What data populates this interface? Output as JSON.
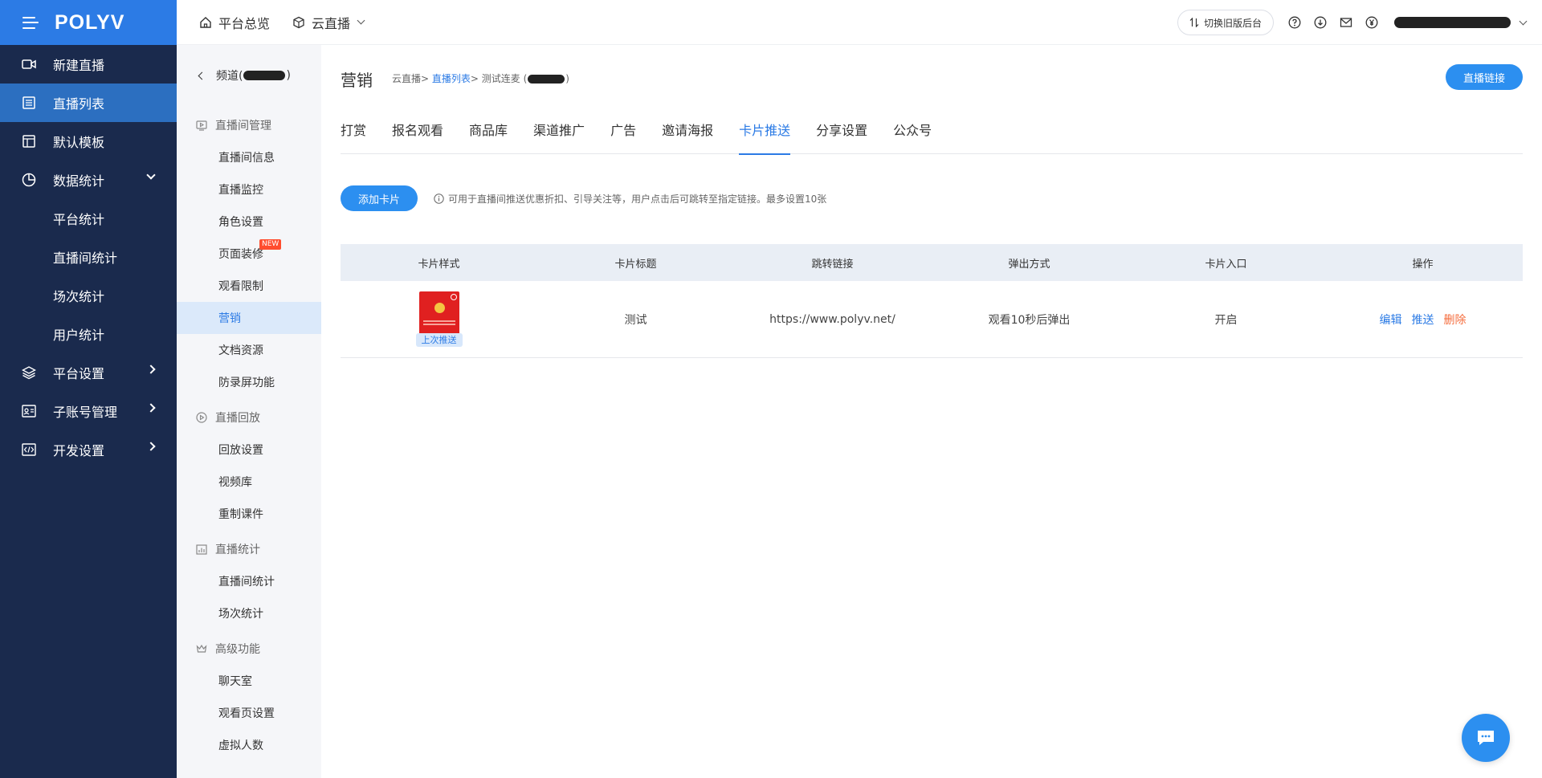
{
  "brand": {
    "logo": "POLYV",
    "accent": "#2c7be5",
    "nav_bg": "#1a2a4d"
  },
  "nav": [
    {
      "label": "新建直播",
      "icon": "video-camera-icon",
      "active": false
    },
    {
      "label": "直播列表",
      "icon": "list-icon",
      "active": true
    },
    {
      "label": "默认模板",
      "icon": "template-icon",
      "active": false
    },
    {
      "label": "数据统计",
      "icon": "pie-chart-icon",
      "expanded": true
    },
    {
      "label": "平台统计"
    },
    {
      "label": "直播间统计"
    },
    {
      "label": "场次统计"
    },
    {
      "label": "用户统计"
    },
    {
      "label": "平台设置",
      "icon": "layers-icon"
    },
    {
      "label": "子账号管理",
      "icon": "id-card-icon"
    },
    {
      "label": "开发设置",
      "icon": "code-icon"
    }
  ],
  "topbar": {
    "overview": "平台总览",
    "cloud_live": "云直播",
    "switch_old": "切换旧版后台",
    "icons": [
      "help-icon",
      "download-icon",
      "mail-icon",
      "yen-icon"
    ]
  },
  "submenu": {
    "back_label_prefix": "频道(",
    "back_label_suffix": ")",
    "groups": [
      {
        "title": "直播间管理",
        "items": [
          "直播间信息",
          "直播监控",
          "角色设置",
          "页面装修",
          "观看限制",
          "营销",
          "文档资源",
          "防录屏功能"
        ]
      },
      {
        "title": "直播回放",
        "items": [
          "回放设置",
          "视频库",
          "重制课件"
        ]
      },
      {
        "title": "直播统计",
        "items": [
          "直播间统计",
          "场次统计"
        ]
      },
      {
        "title": "高级功能",
        "items": [
          "聊天室",
          "观看页设置",
          "虚拟人数"
        ]
      }
    ],
    "new_badge": "NEW"
  },
  "page": {
    "title": "营销",
    "breadcrumb": {
      "root": "云直播>",
      "list": "直播列表",
      "sep": ">",
      "current_prefix": "测试连麦 (",
      "current_suffix": ")"
    },
    "live_link_btn": "直播链接",
    "tabs": [
      "打赏",
      "报名观看",
      "商品库",
      "渠道推广",
      "广告",
      "邀请海报",
      "卡片推送",
      "分享设置",
      "公众号"
    ],
    "active_tab": "卡片推送",
    "add_card_btn": "添加卡片",
    "tip": "可用于直播间推送优惠折扣、引导关注等，用户点击后可跳转至指定链接。最多设置10张"
  },
  "table": {
    "headers": [
      "卡片样式",
      "卡片标题",
      "跳转链接",
      "弹出方式",
      "卡片入口",
      "操作"
    ],
    "rows": [
      {
        "last_push": "上次推送",
        "title": "测试",
        "link": "https://www.polyv.net/",
        "popup": "观看10秒后弹出",
        "entry": "开启",
        "ops": {
          "edit": "编辑",
          "push": "推送",
          "delete": "删除"
        }
      }
    ]
  }
}
